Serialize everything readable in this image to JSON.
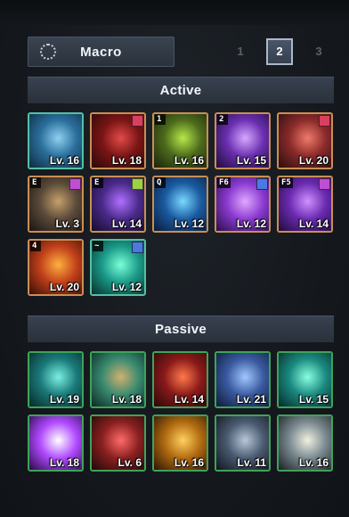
{
  "macro": {
    "label": "Macro",
    "icon": "dotted-circle-icon"
  },
  "pages": [
    "1",
    "2",
    "3"
  ],
  "active_page": "2",
  "active_section": {
    "title": "Active",
    "skills": [
      {
        "name": "skill-wind-slash",
        "level": "Lv. 16",
        "hotkey": "",
        "badge": "",
        "colors": [
          "#8fd0f0",
          "#2a6f9c",
          "#0f2b40"
        ]
      },
      {
        "name": "skill-blade-rain",
        "level": "Lv. 18",
        "hotkey": "",
        "badge": "#d94060",
        "colors": [
          "#e24a4a",
          "#7a1515",
          "#2a0a0a"
        ]
      },
      {
        "name": "skill-green-lash",
        "level": "Lv. 16",
        "hotkey": "1",
        "badge": "",
        "colors": [
          "#b6e84a",
          "#4d6b1c",
          "#1a220c"
        ]
      },
      {
        "name": "skill-void-crescent",
        "level": "Lv. 15",
        "hotkey": "2",
        "badge": "",
        "colors": [
          "#d6a8ff",
          "#6a2fb0",
          "#1e0c38"
        ]
      },
      {
        "name": "skill-shield-charge",
        "level": "Lv. 20",
        "hotkey": "",
        "badge": "#d94060",
        "colors": [
          "#f07a6a",
          "#8a2a2a",
          "#2a0e0e"
        ]
      },
      {
        "name": "skill-dark-knight",
        "level": "Lv. 3",
        "hotkey": "E",
        "badge": "#c04fd0",
        "colors": [
          "#c6a06a",
          "#5a4a3a",
          "#1a1410"
        ]
      },
      {
        "name": "skill-shadow-warrior",
        "level": "Lv. 14",
        "hotkey": "E",
        "badge": "#9ed04a",
        "colors": [
          "#b070ff",
          "#4a2a8a",
          "#150c28"
        ]
      },
      {
        "name": "skill-frost-sigil",
        "level": "Lv. 12",
        "hotkey": "Q",
        "badge": "",
        "colors": [
          "#7ad8ff",
          "#1a5aa0",
          "#0a1a38"
        ]
      },
      {
        "name": "skill-arcane-blade",
        "level": "Lv. 12",
        "hotkey": "F6",
        "badge": "#4a7ae0",
        "colors": [
          "#e0a8ff",
          "#8a3ad0",
          "#280e48"
        ]
      },
      {
        "name": "skill-phantom-sword",
        "level": "Lv. 14",
        "hotkey": "F5",
        "badge": "#c04fd0",
        "colors": [
          "#d090ff",
          "#6a2ab0",
          "#200c3a"
        ]
      },
      {
        "name": "skill-flame-wave",
        "level": "Lv. 20",
        "hotkey": "4",
        "badge": "",
        "colors": [
          "#ffb040",
          "#c0401a",
          "#3a0e08"
        ]
      },
      {
        "name": "skill-jade-vortex",
        "level": "Lv. 12",
        "hotkey": "~",
        "badge": "#4a7ae0",
        "colors": [
          "#7affd8",
          "#1a9a88",
          "#08302c"
        ]
      }
    ]
  },
  "passive_section": {
    "title": "Passive",
    "skills": [
      {
        "name": "passive-spirit-aura",
        "level": "Lv. 19",
        "colors": [
          "#7af0e0",
          "#1a7a7a",
          "#082828"
        ]
      },
      {
        "name": "passive-guardian-shield",
        "level": "Lv. 18",
        "colors": [
          "#d0b070",
          "#3a8a70",
          "#0a2a24"
        ]
      },
      {
        "name": "passive-blood-rage",
        "level": "Lv. 14",
        "colors": [
          "#ff7a4a",
          "#8a1a1a",
          "#2a0808"
        ]
      },
      {
        "name": "passive-iron-will",
        "level": "Lv. 21",
        "colors": [
          "#a0c8ff",
          "#3a5aa0",
          "#0e1a38"
        ]
      },
      {
        "name": "passive-tranquil-mind",
        "level": "Lv. 15",
        "colors": [
          "#8affe0",
          "#1a8a80",
          "#082a28"
        ]
      },
      {
        "name": "passive-astral-burst",
        "level": "Lv. 18",
        "colors": [
          "#ffffff",
          "#b04aff",
          "#2a0a48"
        ]
      },
      {
        "name": "passive-war-cry",
        "level": "Lv. 6",
        "colors": [
          "#ff6a6a",
          "#8a2020",
          "#200808"
        ]
      },
      {
        "name": "passive-golden-knight",
        "level": "Lv. 16",
        "colors": [
          "#ffd060",
          "#b06a10",
          "#2a1404"
        ]
      },
      {
        "name": "passive-steel-armor",
        "level": "Lv. 11",
        "colors": [
          "#b8c8d8",
          "#4a5a70",
          "#10161e"
        ]
      },
      {
        "name": "passive-holy-guard",
        "level": "Lv. 16",
        "colors": [
          "#f0f0e0",
          "#7a8a90",
          "#1a2024"
        ]
      }
    ]
  }
}
